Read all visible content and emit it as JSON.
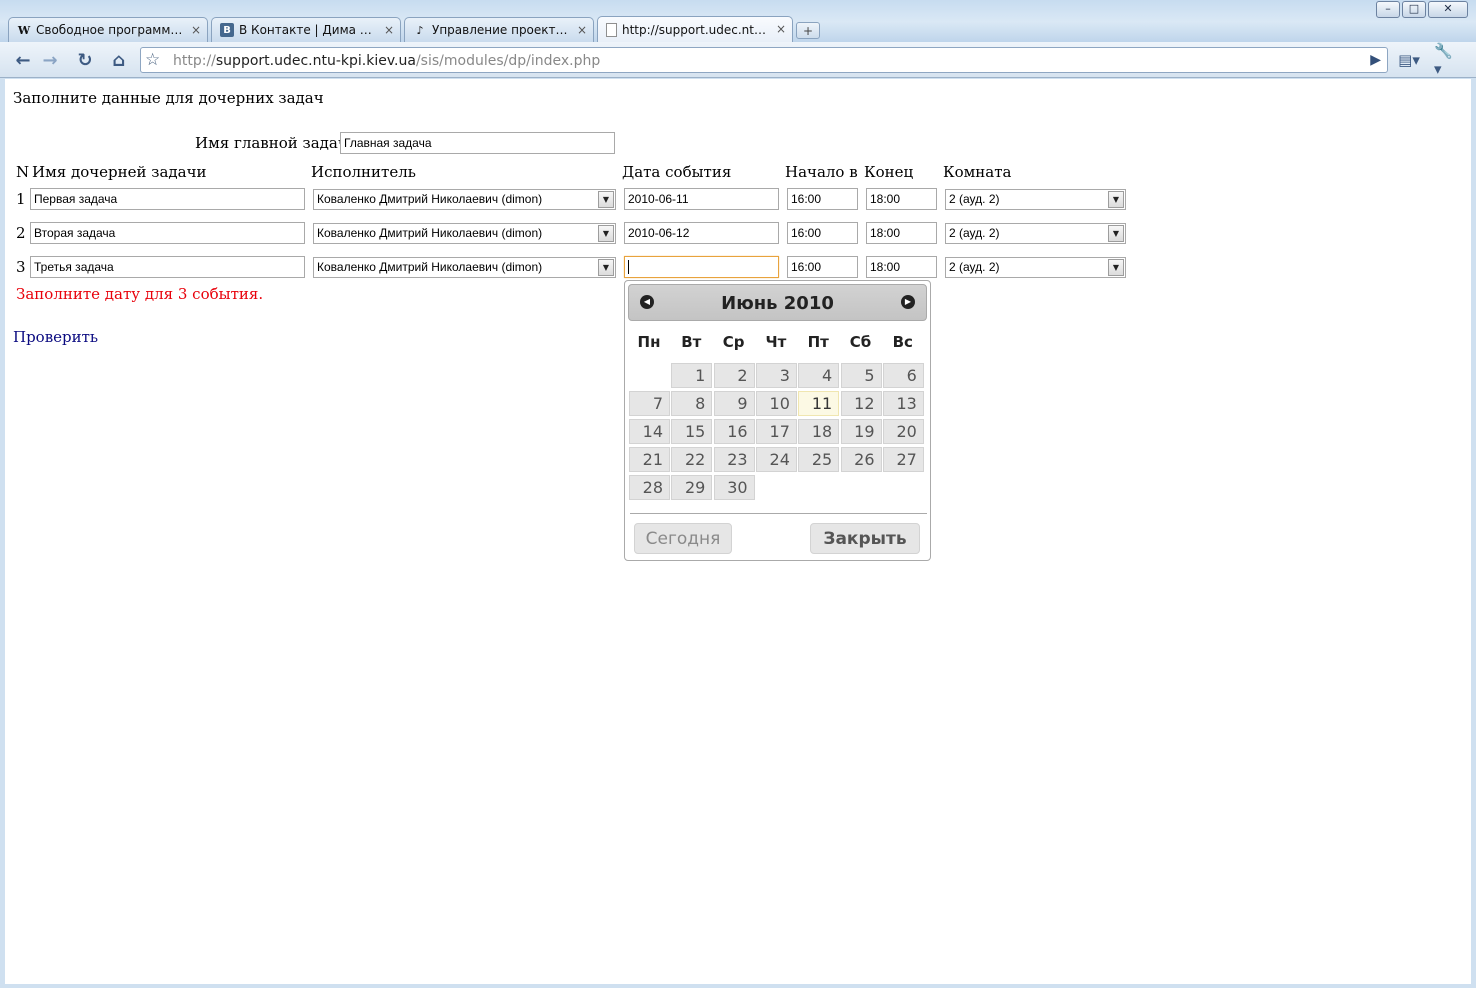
{
  "browser": {
    "tabs": [
      {
        "label": "Свободное программн...",
        "icon": "wikipedia-icon",
        "active": false
      },
      {
        "label": "В Контакте | Дима Ковал...",
        "icon": "vk-icon",
        "active": false
      },
      {
        "label": "Управление проектами",
        "icon": "redmine-icon",
        "active": false
      },
      {
        "label": "http://support.udec.ntu-...",
        "icon": "page-icon",
        "active": true
      }
    ],
    "url_prefix": "http://",
    "url_host": "support.udec.ntu-kpi.kiev.ua",
    "url_path": "/sis/modules/dp/index.php",
    "window_buttons": {
      "minimize": "–",
      "maximize": "□",
      "close": "✕"
    },
    "tab_close": "×",
    "new_tab": "+"
  },
  "page": {
    "heading": "Заполните данные для дочерних задач",
    "main_task_label": "Имя главной задачи:",
    "main_task_value": "Главная задача",
    "columns": [
      "N",
      "Имя дочерней задачи",
      "Исполнитель",
      "Дата события",
      "Начало в",
      "Конец",
      "Комната"
    ],
    "rows": [
      {
        "n": "1",
        "name": "Первая задача",
        "assignee": "Коваленко Дмитрий Николаевич (dimon)",
        "date": "2010-06-11",
        "start": "16:00",
        "end": "18:00",
        "room": "2 (ауд. 2)"
      },
      {
        "n": "2",
        "name": "Вторая задача",
        "assignee": "Коваленко Дмитрий Николаевич (dimon)",
        "date": "2010-06-12",
        "start": "16:00",
        "end": "18:00",
        "room": "2 (ауд. 2)"
      },
      {
        "n": "3",
        "name": "Третья задача",
        "assignee": "Коваленко Дмитрий Николаевич (dimon)",
        "date": "",
        "start": "16:00",
        "end": "18:00",
        "room": "2 (ауд. 2)"
      }
    ],
    "error": "Заполните дату для 3 события.",
    "check_link": "Проверить"
  },
  "datepicker": {
    "title": "Июнь 2010",
    "weekdays": [
      "Пн",
      "Вт",
      "Ср",
      "Чт",
      "Пт",
      "Сб",
      "Вс"
    ],
    "days_in_month": 30,
    "first_weekday_index": 1,
    "today": 11,
    "today_button": "Сегодня",
    "close_button": "Закрыть"
  }
}
